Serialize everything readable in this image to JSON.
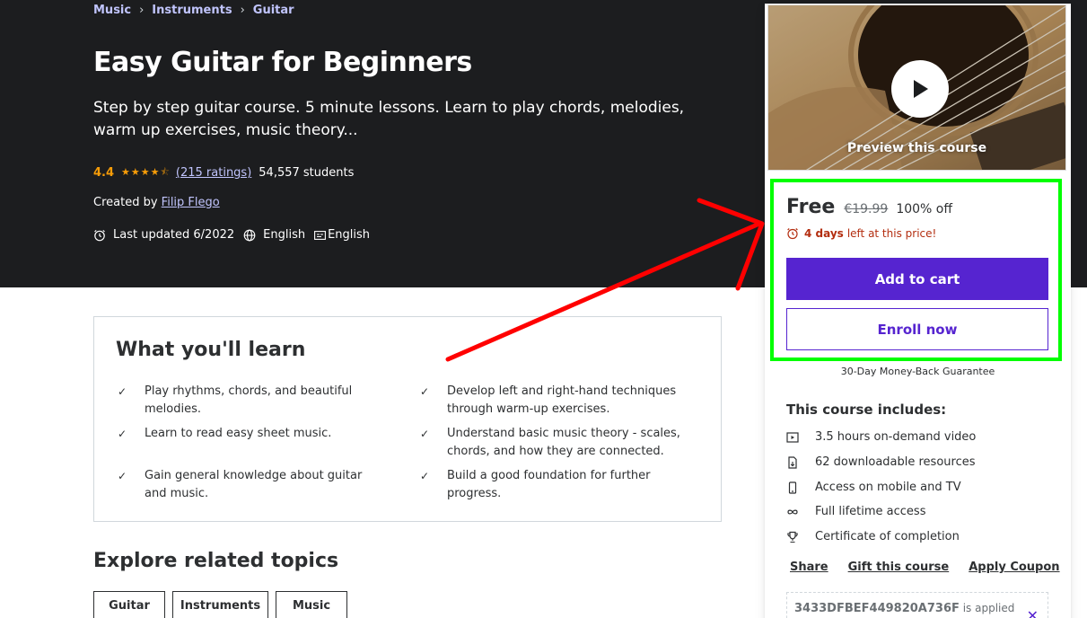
{
  "breadcrumb": [
    "Music",
    "Instruments",
    "Guitar"
  ],
  "breadcrumb_sep": "›",
  "course": {
    "title": "Easy Guitar for Beginners",
    "subtitle": "Step by step guitar course. 5 minute lessons. Learn to play chords, melodies, warm up exercises, music theory...",
    "rating": "4.4",
    "rating_value": 4.4,
    "ratings_count": "(215 ratings)",
    "students": "54,557 students",
    "created_label": "Created by",
    "author": "Filip Flego",
    "last_updated": "Last updated 6/2022",
    "language": "English",
    "captions": "English"
  },
  "learn": {
    "title": "What you'll learn",
    "items": [
      "Play rhythms, chords, and beautiful melodies.",
      "Develop left and right-hand techniques through warm-up exercises.",
      "Learn to read easy sheet music.",
      "Understand basic music theory - scales, chords, and how they are connected.",
      "Gain general knowledge about guitar and music.",
      "Build a good foundation for further progress."
    ]
  },
  "explore": {
    "title": "Explore related topics",
    "topics": [
      "Guitar",
      "Instruments",
      "Music"
    ]
  },
  "sidebar": {
    "preview_label": "Preview this course",
    "price": "Free",
    "original_price": "€19.99",
    "discount": "100% off",
    "timer_bold": "4 days",
    "timer_rest": "left at this price!",
    "add_to_cart": "Add to cart",
    "enroll_now": "Enroll now",
    "guarantee": "30-Day Money-Back Guarantee",
    "includes_title": "This course includes:",
    "includes": [
      {
        "icon": "video-icon",
        "label": "3.5 hours on-demand video"
      },
      {
        "icon": "download-file-icon",
        "label": "62 downloadable resources"
      },
      {
        "icon": "mobile-icon",
        "label": "Access on mobile and TV"
      },
      {
        "icon": "infinity-icon",
        "label": "Full lifetime access"
      },
      {
        "icon": "trophy-icon",
        "label": "Certificate of completion"
      }
    ],
    "share": "Share",
    "gift": "Gift this course",
    "apply_coupon": "Apply Coupon",
    "coupon_code": "3433DFBEF449820A736F",
    "coupon_applied": "is applied"
  },
  "colors": {
    "hero_bg": "#1c1d1f",
    "accent_purple": "#5624d0",
    "star": "#f69c08",
    "link_light": "#c0c4fc",
    "timer_red": "#b32d0f",
    "highlight_green": "#00ff00",
    "annotation_red": "#ff0000"
  }
}
